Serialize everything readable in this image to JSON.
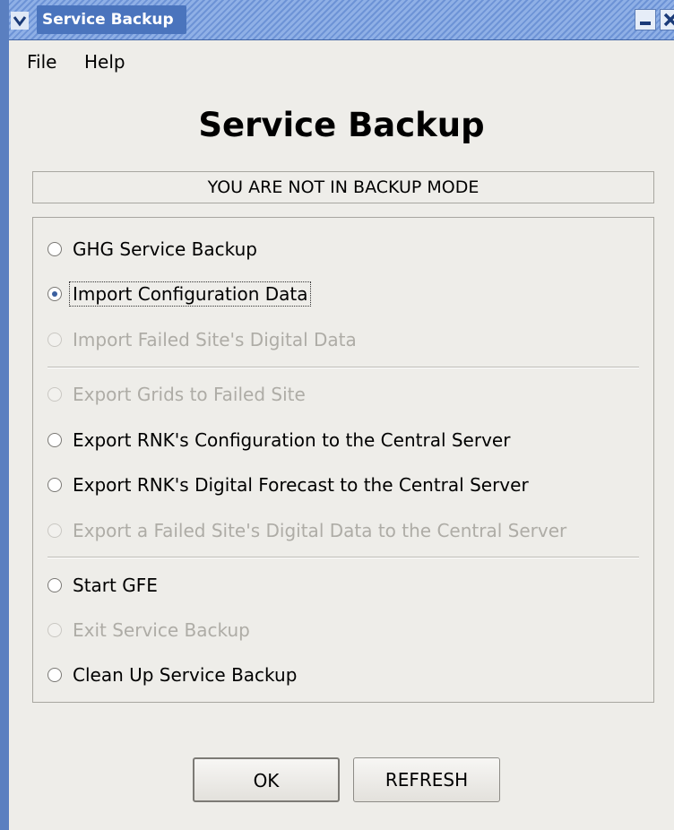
{
  "window": {
    "title": "Service Backup"
  },
  "menubar": {
    "items": [
      "File",
      "Help"
    ]
  },
  "heading": "Service Backup",
  "status": "YOU ARE NOT IN BACKUP MODE",
  "options": [
    {
      "label": "GHG Service Backup",
      "enabled": true,
      "selected": false
    },
    {
      "label": "Import Configuration Data",
      "enabled": true,
      "selected": true
    },
    {
      "label": "Import Failed Site's Digital Data",
      "enabled": false,
      "selected": false
    },
    {
      "label": "Export Grids to Failed Site",
      "enabled": false,
      "selected": false
    },
    {
      "label": "Export RNK's Configuration to the Central Server",
      "enabled": true,
      "selected": false
    },
    {
      "label": "Export RNK's Digital Forecast to the Central Server",
      "enabled": true,
      "selected": false
    },
    {
      "label": "Export a Failed Site's Digital Data to the Central Server",
      "enabled": false,
      "selected": false
    },
    {
      "label": "Start GFE",
      "enabled": true,
      "selected": false
    },
    {
      "label": "Exit Service Backup",
      "enabled": false,
      "selected": false
    },
    {
      "label": "Clean Up Service Backup",
      "enabled": true,
      "selected": false
    }
  ],
  "buttons": {
    "ok": "OK",
    "refresh": "REFRESH"
  }
}
